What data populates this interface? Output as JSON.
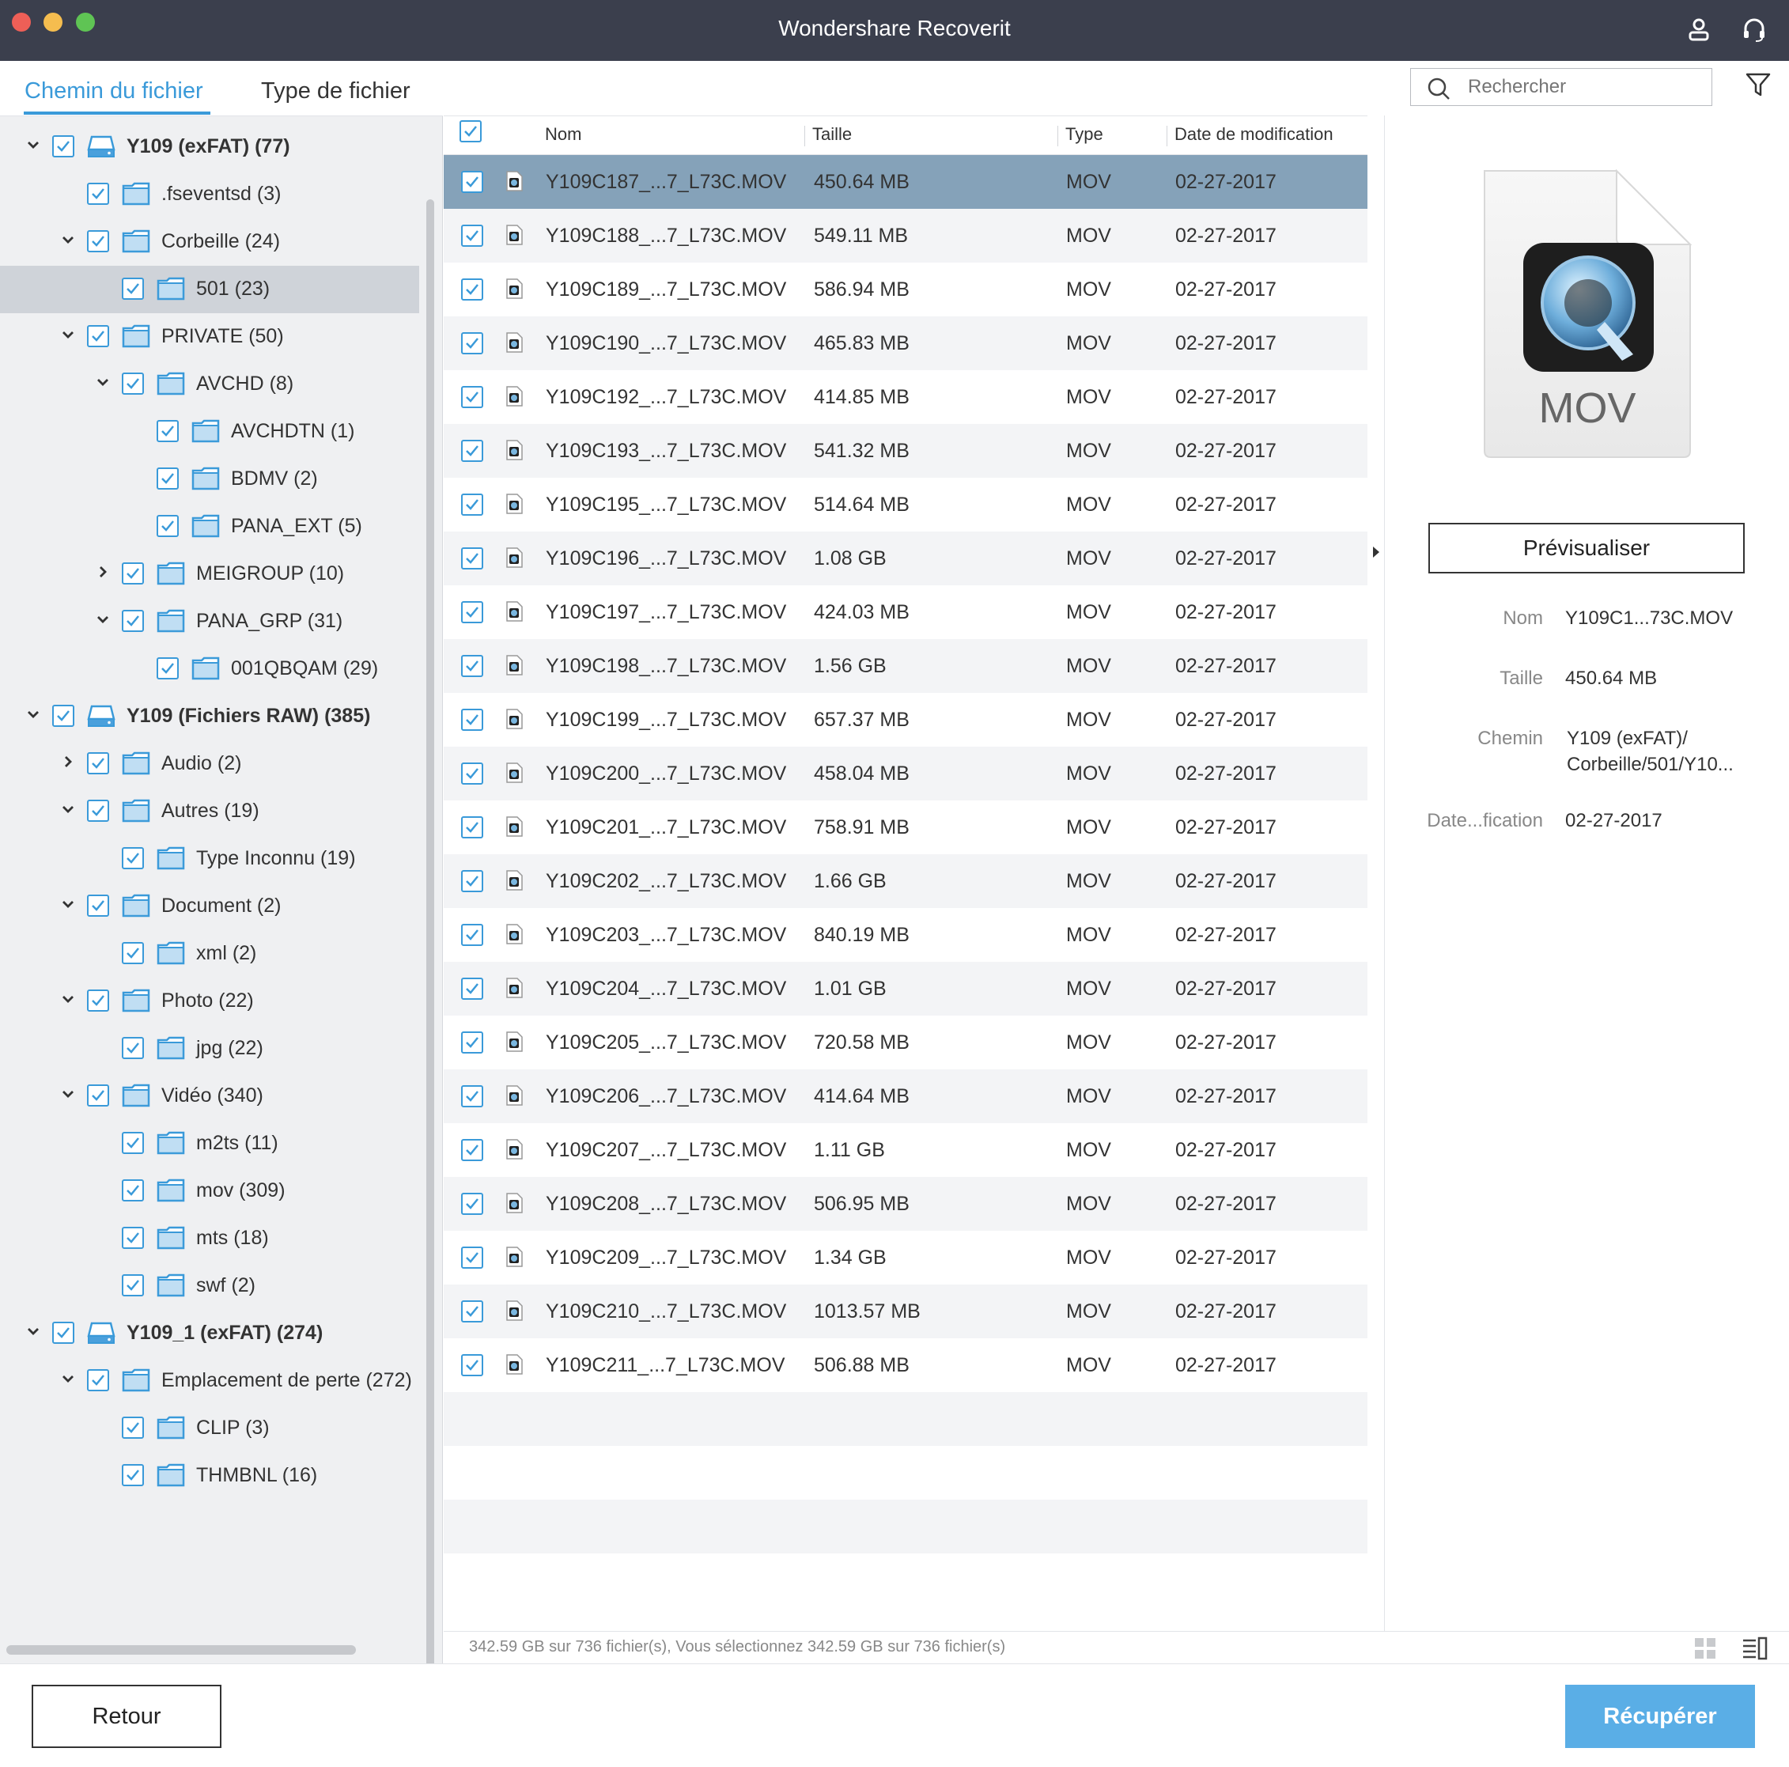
{
  "window": {
    "title": "Wondershare Recoverit"
  },
  "tabs": {
    "path_label": "Chemin du fichier",
    "type_label": "Type de fichier"
  },
  "tree": [
    {
      "label": "Y109 (exFAT) (77)",
      "level": 0,
      "kind": "drive",
      "expanded": true,
      "bold": true
    },
    {
      "label": ".fseventsd (3)",
      "level": 1,
      "kind": "folder",
      "expanded": null
    },
    {
      "label": "Corbeille (24)",
      "level": 1,
      "kind": "folder",
      "expanded": true
    },
    {
      "label": "501 (23)",
      "level": 2,
      "kind": "folder",
      "expanded": null,
      "selected": true
    },
    {
      "label": "PRIVATE (50)",
      "level": 1,
      "kind": "folder",
      "expanded": true
    },
    {
      "label": "AVCHD (8)",
      "level": 2,
      "kind": "folder",
      "expanded": true
    },
    {
      "label": "AVCHDTN (1)",
      "level": 3,
      "kind": "folder",
      "expanded": null
    },
    {
      "label": "BDMV (2)",
      "level": 3,
      "kind": "folder",
      "expanded": null
    },
    {
      "label": "PANA_EXT (5)",
      "level": 3,
      "kind": "folder",
      "expanded": null
    },
    {
      "label": "MEIGROUP (10)",
      "level": 2,
      "kind": "folder",
      "expanded": false
    },
    {
      "label": "PANA_GRP (31)",
      "level": 2,
      "kind": "folder",
      "expanded": true
    },
    {
      "label": "001QBQAM (29)",
      "level": 3,
      "kind": "folder",
      "expanded": null
    },
    {
      "label": "Y109 (Fichiers RAW) (385)",
      "level": 0,
      "kind": "drive",
      "expanded": true,
      "bold": true
    },
    {
      "label": "Audio (2)",
      "level": 1,
      "kind": "folder",
      "expanded": false
    },
    {
      "label": "Autres (19)",
      "level": 1,
      "kind": "folder",
      "expanded": true
    },
    {
      "label": "Type Inconnu (19)",
      "level": 2,
      "kind": "folder",
      "expanded": null
    },
    {
      "label": "Document (2)",
      "level": 1,
      "kind": "folder",
      "expanded": true
    },
    {
      "label": "xml (2)",
      "level": 2,
      "kind": "folder",
      "expanded": null
    },
    {
      "label": "Photo (22)",
      "level": 1,
      "kind": "folder",
      "expanded": true
    },
    {
      "label": "jpg (22)",
      "level": 2,
      "kind": "folder",
      "expanded": null
    },
    {
      "label": "Vidéo (340)",
      "level": 1,
      "kind": "folder",
      "expanded": true
    },
    {
      "label": "m2ts (11)",
      "level": 2,
      "kind": "folder",
      "expanded": null
    },
    {
      "label": "mov (309)",
      "level": 2,
      "kind": "folder",
      "expanded": null
    },
    {
      "label": "mts (18)",
      "level": 2,
      "kind": "folder",
      "expanded": null
    },
    {
      "label": "swf (2)",
      "level": 2,
      "kind": "folder",
      "expanded": null
    },
    {
      "label": "Y109_1 (exFAT) (274)",
      "level": 0,
      "kind": "drive",
      "expanded": true,
      "bold": true
    },
    {
      "label": "Emplacement de perte (272)",
      "level": 1,
      "kind": "folder",
      "expanded": true
    },
    {
      "label": "CLIP (3)",
      "level": 2,
      "kind": "folder",
      "expanded": null
    },
    {
      "label": "THMBNL (16)",
      "level": 2,
      "kind": "folder",
      "expanded": null
    }
  ],
  "search": {
    "placeholder": "Rechercher"
  },
  "columns": {
    "name": "Nom",
    "size": "Taille",
    "type": "Type",
    "date": "Date de modification"
  },
  "files": [
    {
      "name": "Y109C187_...7_L73C.MOV",
      "size": "450.64 MB",
      "type": "MOV",
      "date": "02-27-2017"
    },
    {
      "name": "Y109C188_...7_L73C.MOV",
      "size": "549.11 MB",
      "type": "MOV",
      "date": "02-27-2017"
    },
    {
      "name": "Y109C189_...7_L73C.MOV",
      "size": "586.94 MB",
      "type": "MOV",
      "date": "02-27-2017"
    },
    {
      "name": "Y109C190_...7_L73C.MOV",
      "size": "465.83 MB",
      "type": "MOV",
      "date": "02-27-2017"
    },
    {
      "name": "Y109C192_...7_L73C.MOV",
      "size": "414.85 MB",
      "type": "MOV",
      "date": "02-27-2017"
    },
    {
      "name": "Y109C193_...7_L73C.MOV",
      "size": "541.32 MB",
      "type": "MOV",
      "date": "02-27-2017"
    },
    {
      "name": "Y109C195_...7_L73C.MOV",
      "size": "514.64 MB",
      "type": "MOV",
      "date": "02-27-2017"
    },
    {
      "name": "Y109C196_...7_L73C.MOV",
      "size": "1.08 GB",
      "type": "MOV",
      "date": "02-27-2017"
    },
    {
      "name": "Y109C197_...7_L73C.MOV",
      "size": "424.03 MB",
      "type": "MOV",
      "date": "02-27-2017"
    },
    {
      "name": "Y109C198_...7_L73C.MOV",
      "size": "1.56 GB",
      "type": "MOV",
      "date": "02-27-2017"
    },
    {
      "name": "Y109C199_...7_L73C.MOV",
      "size": "657.37 MB",
      "type": "MOV",
      "date": "02-27-2017"
    },
    {
      "name": "Y109C200_...7_L73C.MOV",
      "size": "458.04 MB",
      "type": "MOV",
      "date": "02-27-2017"
    },
    {
      "name": "Y109C201_...7_L73C.MOV",
      "size": "758.91 MB",
      "type": "MOV",
      "date": "02-27-2017"
    },
    {
      "name": "Y109C202_...7_L73C.MOV",
      "size": "1.66 GB",
      "type": "MOV",
      "date": "02-27-2017"
    },
    {
      "name": "Y109C203_...7_L73C.MOV",
      "size": "840.19 MB",
      "type": "MOV",
      "date": "02-27-2017"
    },
    {
      "name": "Y109C204_...7_L73C.MOV",
      "size": "1.01 GB",
      "type": "MOV",
      "date": "02-27-2017"
    },
    {
      "name": "Y109C205_...7_L73C.MOV",
      "size": "720.58 MB",
      "type": "MOV",
      "date": "02-27-2017"
    },
    {
      "name": "Y109C206_...7_L73C.MOV",
      "size": "414.64 MB",
      "type": "MOV",
      "date": "02-27-2017"
    },
    {
      "name": "Y109C207_...7_L73C.MOV",
      "size": "1.11 GB",
      "type": "MOV",
      "date": "02-27-2017"
    },
    {
      "name": "Y109C208_...7_L73C.MOV",
      "size": "506.95 MB",
      "type": "MOV",
      "date": "02-27-2017"
    },
    {
      "name": "Y109C209_...7_L73C.MOV",
      "size": "1.34 GB",
      "type": "MOV",
      "date": "02-27-2017"
    },
    {
      "name": "Y109C210_...7_L73C.MOV",
      "size": "1013.57 MB",
      "type": "MOV",
      "date": "02-27-2017"
    },
    {
      "name": "Y109C211_...7_L73C.MOV",
      "size": "506.88 MB",
      "type": "MOV",
      "date": "02-27-2017"
    }
  ],
  "selected_index": 0,
  "preview": {
    "doc_label": "MOV",
    "button_label": "Prévisualiser",
    "name_key": "Nom",
    "name_val": "Y109C1...73C.MOV",
    "size_key": "Taille",
    "size_val": "450.64 MB",
    "path_key": "Chemin",
    "path_val_1": "Y109 (exFAT)/",
    "path_val_2": "Corbeille/501/Y10...",
    "date_key": "Date...fication",
    "date_val": "02-27-2017"
  },
  "status": {
    "text": "342.59 GB sur 736 fichier(s), Vous sélectionnez 342.59 GB sur 736 fichier(s)"
  },
  "buttons": {
    "back": "Retour",
    "recover": "Récupérer"
  },
  "colors": {
    "accent": "#3a9ad9",
    "selected_row": "#85a2b9",
    "titlebar": "#3b3f4d",
    "recover_button": "#5aaee6"
  },
  "icons": [
    "user-icon",
    "headset-icon",
    "search-icon",
    "filter-icon",
    "grid-view-icon",
    "list-view-icon",
    "quicktime-icon",
    "folder-icon",
    "drive-icon",
    "checkbox-icon",
    "chevron-down-icon",
    "chevron-right-icon"
  ]
}
